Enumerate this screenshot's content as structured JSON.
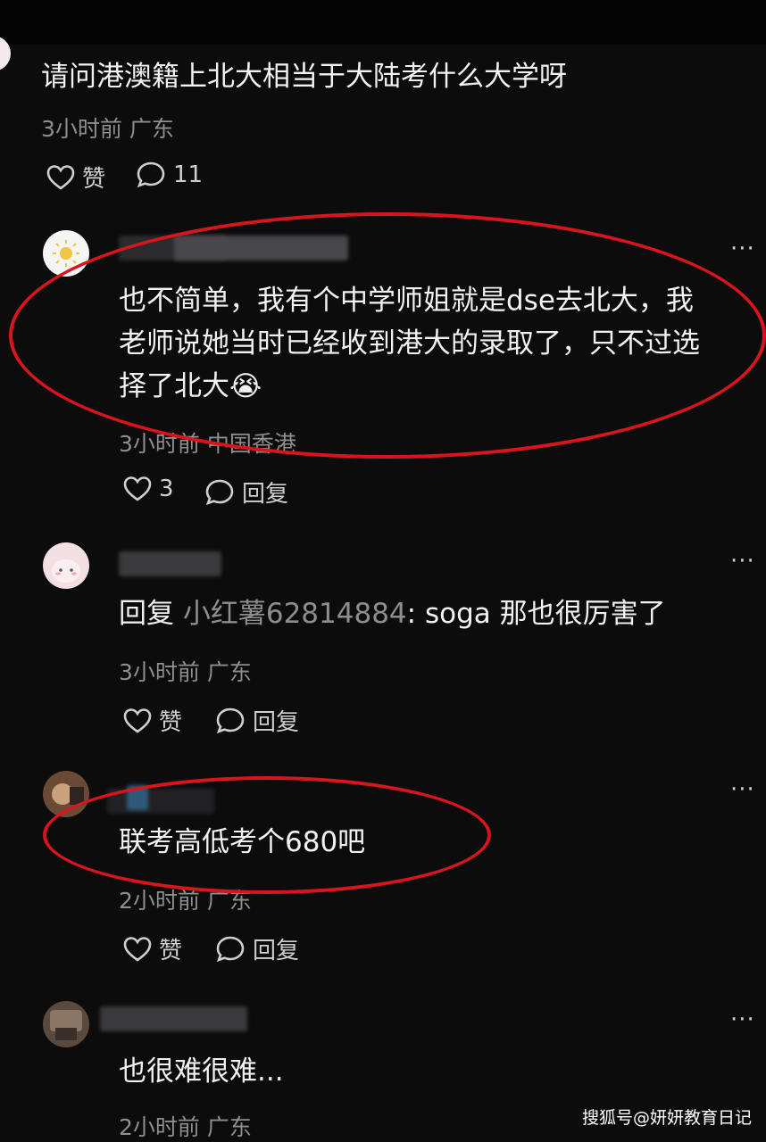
{
  "post": {
    "text": "请问港澳籍上北大相当于大陆考什么大学呀",
    "meta": "3小时前 广东",
    "like_label": "赞",
    "comment_count": "11"
  },
  "comments": [
    {
      "line1": "也不简单，我有个中学师姐就是dse去北大，我",
      "line2": "老师说她当时已经收到港大的录取了，只不过选",
      "line3": "择了北大",
      "emoji": "😭",
      "meta": "3小时前 中国香港",
      "like_count": "3",
      "reply_label": "回复",
      "more": "···"
    },
    {
      "reply_prefix": "回复",
      "reply_to": "小红薯62814884",
      "separator": ":",
      "text": "soga 那也很厉害了",
      "meta": "3小时前 广东",
      "like_label": "赞",
      "reply_label": "回复",
      "more": "···"
    },
    {
      "text": "联考高低考个680吧",
      "meta": "2小时前 广东",
      "like_label": "赞",
      "reply_label": "回复",
      "more": "···"
    },
    {
      "text": "也很难很难...",
      "meta": "2小时前 广东",
      "more": "···"
    }
  ],
  "watermark": "搜狐号@妍妍教育日记",
  "colors": {
    "background": "#0c0c0d",
    "highlight_ring": "#d8141c",
    "meta_gray": "#8e8e8e"
  },
  "icons": [
    "heart-icon",
    "comment-bubble-icon",
    "more-dots-icon"
  ]
}
